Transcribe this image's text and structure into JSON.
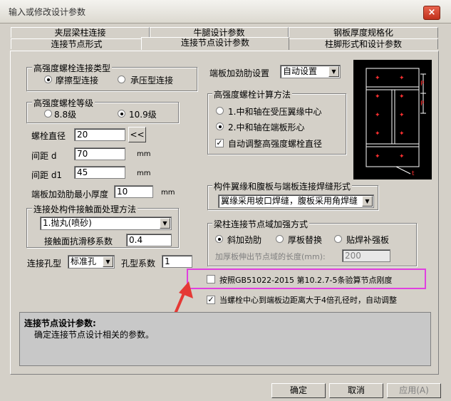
{
  "window": {
    "title": "输入或修改设计参数",
    "close": "×"
  },
  "tabs": {
    "row1": [
      "夹层梁柱连接",
      "牛腿设计参数",
      "钢板厚度规格化"
    ],
    "row2": [
      "连接节点形式",
      "连接节点设计参数",
      "柱脚形式和设计参数"
    ]
  },
  "bolt_type": {
    "legend": "高强度螺栓连接类型",
    "opt1": "摩擦型连接",
    "opt2": "承压型连接",
    "selected": "摩擦型连接"
  },
  "bolt_grade": {
    "legend": "高强度螺栓等级",
    "opt1": "8.8级",
    "opt2": "10.9级",
    "selected": "10.9级"
  },
  "bolt_diameter": {
    "label": "螺栓直径",
    "value": "20",
    "btn": "<<"
  },
  "spacing_d": {
    "label": "间距  d",
    "value": "70",
    "unit": "mm"
  },
  "spacing_d1": {
    "label": "间距  d1",
    "value": "45",
    "unit": "mm"
  },
  "stiffener_thickness": {
    "label": "端板加劲肋最小厚度",
    "value": "10",
    "unit": "mm"
  },
  "surface": {
    "legend": "连接处构件接触面处理方法",
    "method": "1.抛丸(喷砂)",
    "slip_label": "接触面抗滑移系数",
    "slip_value": "0.4"
  },
  "hole": {
    "type_label": "连接孔型",
    "type_value": "标准孔",
    "coef_label": "孔型系数",
    "coef_value": "1"
  },
  "endplate_stiffener": {
    "label": "端板加劲肋设置",
    "value": "自动设置"
  },
  "bolt_calc": {
    "legend": "高强度螺栓计算方法",
    "opt1": "1.中和轴在受压翼缘中心",
    "opt2": "2.中和轴在端板形心",
    "selected": "2.中和轴在端板形心",
    "auto_adjust": "自动调整高强度螺栓直径",
    "auto_adjust_checked": true
  },
  "weld": {
    "legend": "构件翼缘和腹板与端板连接焊缝形式",
    "value": "翼缘采用坡口焊缝，腹板采用角焊缝"
  },
  "joint_reinforce": {
    "legend": "梁柱连接节点域加强方式",
    "opt1": "斜加劲肋",
    "opt2": "厚板替换",
    "opt3": "贴焊补强板",
    "selected": "斜加劲肋",
    "extend_label": "加厚板伸出节点域的长度(mm):",
    "extend_value": "200"
  },
  "check_stiffness": {
    "label": "按照GB51022-2015 第10.2.7-5条验算节点刚度",
    "checked": false
  },
  "auto_adjust_edge": {
    "label": "当螺栓中心到端板边距离大于4倍孔径时，自动调整",
    "checked": true
  },
  "help": {
    "title": "连接节点设计参数:",
    "text": "确定连接节点设计相关的参数。"
  },
  "buttons": {
    "ok": "确定",
    "cancel": "取消",
    "apply": "应用(A)"
  },
  "diagram": {
    "labels": [
      "P",
      "P",
      "t"
    ]
  },
  "colors": {
    "highlight": "#e040e0",
    "arrow": "#e53935",
    "diagram_marks": "#ff3030"
  }
}
